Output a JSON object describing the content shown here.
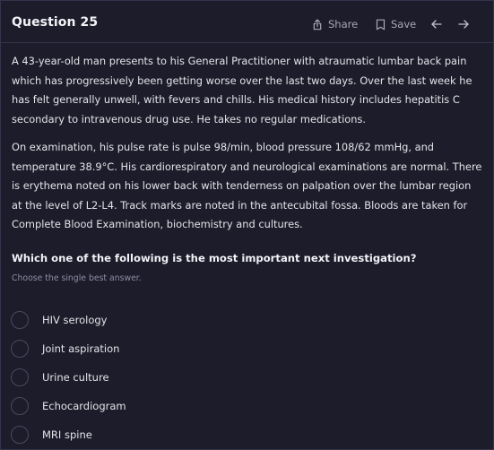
{
  "header": {
    "title": "Question 25",
    "share_label": "Share",
    "save_label": "Save"
  },
  "stem": {
    "paragraph_1": "A 43-year-old man presents to his General Practitioner with atraumatic lumbar back pain which has progressively been getting worse over the last two days. Over the last week he has felt generally unwell, with fevers and chills. His medical history includes hepatitis C secondary to intravenous drug use. He takes no regular medications.",
    "paragraph_2": "On examination, his pulse rate is pulse 98/min, blood pressure 108/62 mmHg, and temperature 38.9°C. His cardiorespiratory and neurological examinations are normal. There is erythema noted on his lower back with tenderness on palpation over the lumbar region at the level of L2-L4. Track marks are noted in the antecubital fossa. Bloods are taken for Complete Blood Examination, biochemistry and cultures."
  },
  "question": {
    "text": "Which one of the following is the most important next investigation?",
    "hint": "Choose the single best answer."
  },
  "options": [
    {
      "label": "HIV serology"
    },
    {
      "label": "Joint aspiration"
    },
    {
      "label": "Urine culture"
    },
    {
      "label": "Echocardiogram"
    },
    {
      "label": "MRI spine"
    }
  ],
  "icons": {
    "share": "share-icon",
    "save": "bookmark-icon",
    "prev": "arrow-left-icon",
    "next": "arrow-right-icon"
  },
  "colors": {
    "background": "#1d1c2a",
    "text": "#e3e3ea",
    "muted": "#8e8da4",
    "radio_border": "#4a4960"
  }
}
